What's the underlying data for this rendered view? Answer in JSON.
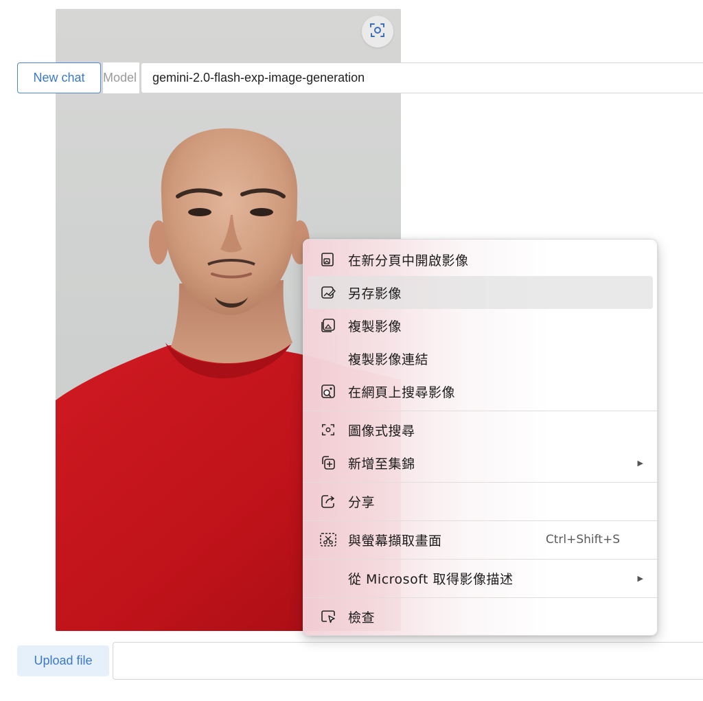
{
  "toolbar": {
    "new_chat_label": "New chat",
    "model_label": "Model",
    "model_value": "gemini-2.0-flash-exp-image-generation"
  },
  "image_overlay": {
    "lens_icon": "visual-search-icon"
  },
  "bottom_bar": {
    "upload_label": "Upload file",
    "message_value": ""
  },
  "context_menu": {
    "items": [
      {
        "label": "在新分頁中開啟影像",
        "icon": "open-image-new-tab-icon"
      },
      {
        "label": "另存影像",
        "icon": "save-image-icon",
        "highlighted": true
      },
      {
        "label": "複製影像",
        "icon": "copy-image-icon"
      },
      {
        "label": "複製影像連結",
        "icon": ""
      },
      {
        "label": "在網頁上搜尋影像",
        "icon": "search-image-web-icon"
      },
      {
        "label": "圖像式搜尋",
        "icon": "visual-search-icon"
      },
      {
        "label": "新增至集錦",
        "icon": "add-to-collections-icon",
        "submenu": true
      },
      {
        "label": "分享",
        "icon": "share-icon"
      },
      {
        "label": "與螢幕擷取畫面",
        "icon": "screenshot-icon",
        "shortcut": "Ctrl+Shift+S"
      },
      {
        "label": "從 Microsoft 取得影像描述",
        "icon": "",
        "submenu": true
      },
      {
        "label": "檢查",
        "icon": "inspect-icon"
      }
    ]
  },
  "colors": {
    "accent": "#3b78c8",
    "shirt": "#c2141c",
    "menu_tint": "#f3d2d8"
  }
}
